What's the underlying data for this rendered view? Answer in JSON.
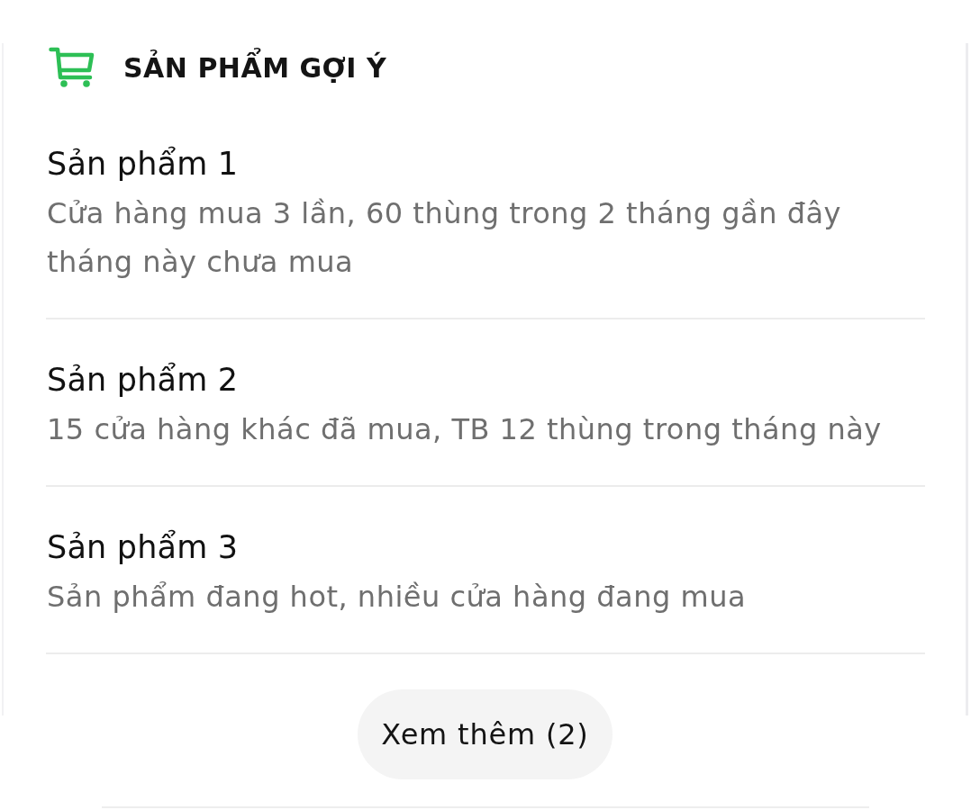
{
  "header": {
    "title": "SẢN PHẨM GỢI Ý"
  },
  "products": [
    {
      "name": "Sản phẩm 1",
      "description": "Cửa hàng mua 3 lần, 60 thùng trong 2 tháng gần đây tháng này chưa mua"
    },
    {
      "name": "Sản phẩm 2",
      "description": "15 cửa hàng khác đã mua, TB 12 thùng trong tháng này"
    },
    {
      "name": "Sản phẩm 3",
      "description": "Sản phẩm đang hot, nhiều cửa hàng đang mua"
    }
  ],
  "more_button": {
    "label": "Xem thêm (2)"
  }
}
